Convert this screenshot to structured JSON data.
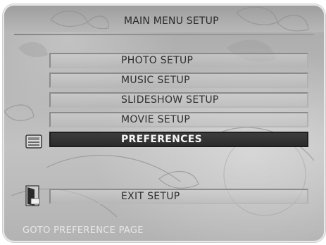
{
  "header": {
    "title": "MAIN MENU SETUP"
  },
  "menu": {
    "items": [
      {
        "label": "PHOTO SETUP",
        "selected": false
      },
      {
        "label": "MUSIC SETUP",
        "selected": false
      },
      {
        "label": "SLIDESHOW SETUP",
        "selected": false
      },
      {
        "label": "MOVIE SETUP",
        "selected": false
      },
      {
        "label": "PREFERENCES",
        "selected": true
      }
    ],
    "exit_label": "EXIT SETUP"
  },
  "icons": {
    "preferences": "preferences-icon",
    "exit": "exit-door-icon"
  },
  "status": {
    "hint": "GOTO PREFERENCE PAGE"
  },
  "colors": {
    "selected_bg": "#2c2c2c",
    "selected_text": "#f5f5f5",
    "item_text": "#2f2f2f",
    "hint_text": "#e8e8e8"
  }
}
